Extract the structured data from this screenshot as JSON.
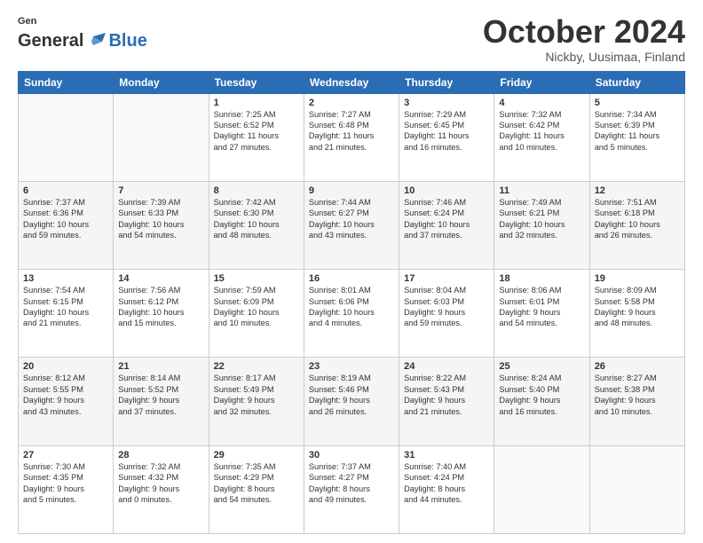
{
  "logo": {
    "general": "General",
    "blue": "Blue"
  },
  "title": "October 2024",
  "subtitle": "Nickby, Uusimaa, Finland",
  "days": [
    "Sunday",
    "Monday",
    "Tuesday",
    "Wednesday",
    "Thursday",
    "Friday",
    "Saturday"
  ],
  "weeks": [
    [
      {
        "day": "",
        "content": ""
      },
      {
        "day": "",
        "content": ""
      },
      {
        "day": "1",
        "content": "Sunrise: 7:25 AM\nSunset: 6:52 PM\nDaylight: 11 hours\nand 27 minutes."
      },
      {
        "day": "2",
        "content": "Sunrise: 7:27 AM\nSunset: 6:48 PM\nDaylight: 11 hours\nand 21 minutes."
      },
      {
        "day": "3",
        "content": "Sunrise: 7:29 AM\nSunset: 6:45 PM\nDaylight: 11 hours\nand 16 minutes."
      },
      {
        "day": "4",
        "content": "Sunrise: 7:32 AM\nSunset: 6:42 PM\nDaylight: 11 hours\nand 10 minutes."
      },
      {
        "day": "5",
        "content": "Sunrise: 7:34 AM\nSunset: 6:39 PM\nDaylight: 11 hours\nand 5 minutes."
      }
    ],
    [
      {
        "day": "6",
        "content": "Sunrise: 7:37 AM\nSunset: 6:36 PM\nDaylight: 10 hours\nand 59 minutes."
      },
      {
        "day": "7",
        "content": "Sunrise: 7:39 AM\nSunset: 6:33 PM\nDaylight: 10 hours\nand 54 minutes."
      },
      {
        "day": "8",
        "content": "Sunrise: 7:42 AM\nSunset: 6:30 PM\nDaylight: 10 hours\nand 48 minutes."
      },
      {
        "day": "9",
        "content": "Sunrise: 7:44 AM\nSunset: 6:27 PM\nDaylight: 10 hours\nand 43 minutes."
      },
      {
        "day": "10",
        "content": "Sunrise: 7:46 AM\nSunset: 6:24 PM\nDaylight: 10 hours\nand 37 minutes."
      },
      {
        "day": "11",
        "content": "Sunrise: 7:49 AM\nSunset: 6:21 PM\nDaylight: 10 hours\nand 32 minutes."
      },
      {
        "day": "12",
        "content": "Sunrise: 7:51 AM\nSunset: 6:18 PM\nDaylight: 10 hours\nand 26 minutes."
      }
    ],
    [
      {
        "day": "13",
        "content": "Sunrise: 7:54 AM\nSunset: 6:15 PM\nDaylight: 10 hours\nand 21 minutes."
      },
      {
        "day": "14",
        "content": "Sunrise: 7:56 AM\nSunset: 6:12 PM\nDaylight: 10 hours\nand 15 minutes."
      },
      {
        "day": "15",
        "content": "Sunrise: 7:59 AM\nSunset: 6:09 PM\nDaylight: 10 hours\nand 10 minutes."
      },
      {
        "day": "16",
        "content": "Sunrise: 8:01 AM\nSunset: 6:06 PM\nDaylight: 10 hours\nand 4 minutes."
      },
      {
        "day": "17",
        "content": "Sunrise: 8:04 AM\nSunset: 6:03 PM\nDaylight: 9 hours\nand 59 minutes."
      },
      {
        "day": "18",
        "content": "Sunrise: 8:06 AM\nSunset: 6:01 PM\nDaylight: 9 hours\nand 54 minutes."
      },
      {
        "day": "19",
        "content": "Sunrise: 8:09 AM\nSunset: 5:58 PM\nDaylight: 9 hours\nand 48 minutes."
      }
    ],
    [
      {
        "day": "20",
        "content": "Sunrise: 8:12 AM\nSunset: 5:55 PM\nDaylight: 9 hours\nand 43 minutes."
      },
      {
        "day": "21",
        "content": "Sunrise: 8:14 AM\nSunset: 5:52 PM\nDaylight: 9 hours\nand 37 minutes."
      },
      {
        "day": "22",
        "content": "Sunrise: 8:17 AM\nSunset: 5:49 PM\nDaylight: 9 hours\nand 32 minutes."
      },
      {
        "day": "23",
        "content": "Sunrise: 8:19 AM\nSunset: 5:46 PM\nDaylight: 9 hours\nand 26 minutes."
      },
      {
        "day": "24",
        "content": "Sunrise: 8:22 AM\nSunset: 5:43 PM\nDaylight: 9 hours\nand 21 minutes."
      },
      {
        "day": "25",
        "content": "Sunrise: 8:24 AM\nSunset: 5:40 PM\nDaylight: 9 hours\nand 16 minutes."
      },
      {
        "day": "26",
        "content": "Sunrise: 8:27 AM\nSunset: 5:38 PM\nDaylight: 9 hours\nand 10 minutes."
      }
    ],
    [
      {
        "day": "27",
        "content": "Sunrise: 7:30 AM\nSunset: 4:35 PM\nDaylight: 9 hours\nand 5 minutes."
      },
      {
        "day": "28",
        "content": "Sunrise: 7:32 AM\nSunset: 4:32 PM\nDaylight: 9 hours\nand 0 minutes."
      },
      {
        "day": "29",
        "content": "Sunrise: 7:35 AM\nSunset: 4:29 PM\nDaylight: 8 hours\nand 54 minutes."
      },
      {
        "day": "30",
        "content": "Sunrise: 7:37 AM\nSunset: 4:27 PM\nDaylight: 8 hours\nand 49 minutes."
      },
      {
        "day": "31",
        "content": "Sunrise: 7:40 AM\nSunset: 4:24 PM\nDaylight: 8 hours\nand 44 minutes."
      },
      {
        "day": "",
        "content": ""
      },
      {
        "day": "",
        "content": ""
      }
    ]
  ]
}
